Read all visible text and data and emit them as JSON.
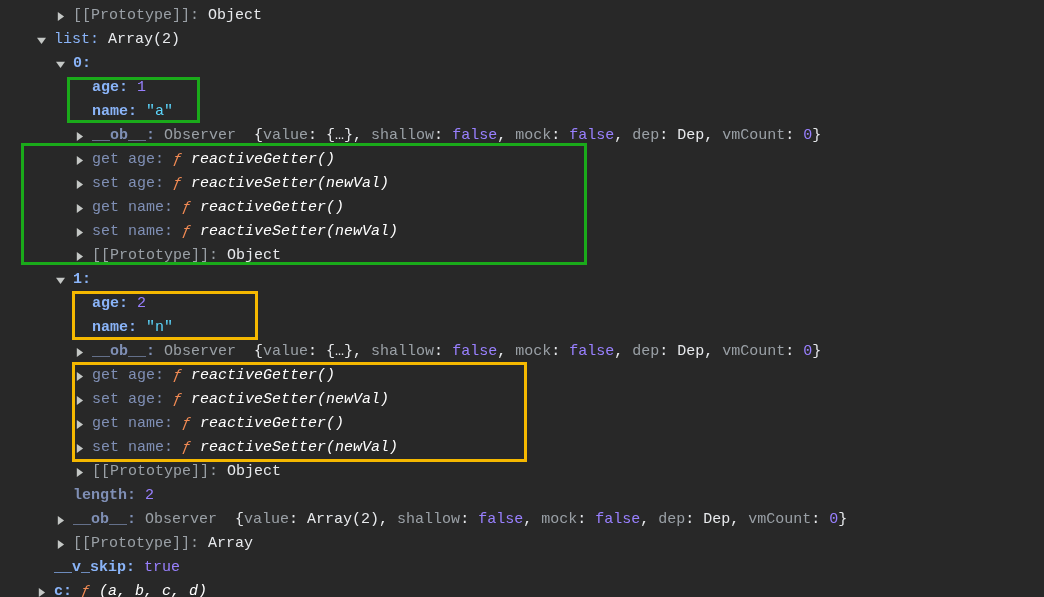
{
  "tree": [
    {
      "children": [
        {
          "key": "[[Prototype]]:",
          "kind": "proto",
          "bold": false,
          "expanded": false,
          "value": [
            {
              "kind": "plain",
              "text": "Object"
            }
          ]
        }
      ]
    },
    {
      "key": "list:",
      "kind": "own",
      "bold": false,
      "expanded": true,
      "value": [
        {
          "kind": "plain",
          "text": "Array(2)"
        }
      ],
      "children": [
        {
          "key": "0:",
          "kind": "own",
          "bold": true,
          "expanded": true,
          "children": [
            {
              "kind": "box",
              "color": "#1aaa1a",
              "children": [
                {
                  "key": "age:",
                  "kind": "own",
                  "bold": true,
                  "value": [
                    {
                      "kind": "num",
                      "text": "1"
                    }
                  ]
                },
                {
                  "key": "name:",
                  "kind": "own",
                  "bold": true,
                  "value": [
                    {
                      "kind": "str",
                      "text": "\"a\""
                    }
                  ]
                }
              ]
            },
            {
              "key": "__ob__:",
              "kind": "inherited",
              "bold": true,
              "expanded": false,
              "value": [
                {
                  "kind": "dim",
                  "text": "Observer  "
                },
                {
                  "kind": "plain",
                  "text": "{"
                },
                {
                  "kind": "dim",
                  "text": "value"
                },
                {
                  "kind": "plain",
                  "text": ": {…}, "
                },
                {
                  "kind": "dim",
                  "text": "shallow"
                },
                {
                  "kind": "plain",
                  "text": ": "
                },
                {
                  "kind": "bool",
                  "text": "false"
                },
                {
                  "kind": "plain",
                  "text": ", "
                },
                {
                  "kind": "dim",
                  "text": "mock"
                },
                {
                  "kind": "plain",
                  "text": ": "
                },
                {
                  "kind": "bool",
                  "text": "false"
                },
                {
                  "kind": "plain",
                  "text": ", "
                },
                {
                  "kind": "dim",
                  "text": "dep"
                },
                {
                  "kind": "plain",
                  "text": ": Dep, "
                },
                {
                  "kind": "dim",
                  "text": "vmCount"
                },
                {
                  "kind": "plain",
                  "text": ": "
                },
                {
                  "kind": "num",
                  "text": "0"
                },
                {
                  "kind": "plain",
                  "text": "}"
                }
              ]
            },
            {
              "kind": "box",
              "color": "#1aaa1a",
              "children": [
                {
                  "key": "get age:",
                  "kind": "inherited",
                  "bold": false,
                  "expanded": false,
                  "value": [
                    {
                      "kind": "fn",
                      "text": "ƒ "
                    },
                    {
                      "kind": "fname",
                      "text": "reactiveGetter()"
                    }
                  ]
                },
                {
                  "key": "set age:",
                  "kind": "inherited",
                  "bold": false,
                  "expanded": false,
                  "value": [
                    {
                      "kind": "fn",
                      "text": "ƒ "
                    },
                    {
                      "kind": "fname",
                      "text": "reactiveSetter(newVal)"
                    }
                  ]
                },
                {
                  "key": "get name:",
                  "kind": "inherited",
                  "bold": false,
                  "expanded": false,
                  "value": [
                    {
                      "kind": "fn",
                      "text": "ƒ "
                    },
                    {
                      "kind": "fname",
                      "text": "reactiveGetter()"
                    }
                  ]
                },
                {
                  "key": "set name:",
                  "kind": "inherited",
                  "bold": false,
                  "expanded": false,
                  "value": [
                    {
                      "kind": "fn",
                      "text": "ƒ "
                    },
                    {
                      "kind": "fname",
                      "text": "reactiveSetter(newVal)"
                    }
                  ]
                },
                {
                  "key": "[[Prototype]]:",
                  "kind": "proto",
                  "bold": false,
                  "expanded": false,
                  "value": [
                    {
                      "kind": "plain",
                      "text": "Object"
                    }
                  ]
                }
              ]
            }
          ]
        },
        {
          "key": "1:",
          "kind": "own",
          "bold": true,
          "expanded": true,
          "children": [
            {
              "kind": "box",
              "color": "#f5b800",
              "children": [
                {
                  "key": "age:",
                  "kind": "own",
                  "bold": true,
                  "value": [
                    {
                      "kind": "num",
                      "text": "2"
                    }
                  ]
                },
                {
                  "key": "name:",
                  "kind": "own",
                  "bold": true,
                  "value": [
                    {
                      "kind": "str",
                      "text": "\"n\""
                    }
                  ]
                }
              ]
            },
            {
              "key": "__ob__:",
              "kind": "inherited",
              "bold": true,
              "expanded": false,
              "value": [
                {
                  "kind": "dim",
                  "text": "Observer  "
                },
                {
                  "kind": "plain",
                  "text": "{"
                },
                {
                  "kind": "dim",
                  "text": "value"
                },
                {
                  "kind": "plain",
                  "text": ": {…}, "
                },
                {
                  "kind": "dim",
                  "text": "shallow"
                },
                {
                  "kind": "plain",
                  "text": ": "
                },
                {
                  "kind": "bool",
                  "text": "false"
                },
                {
                  "kind": "plain",
                  "text": ", "
                },
                {
                  "kind": "dim",
                  "text": "mock"
                },
                {
                  "kind": "plain",
                  "text": ": "
                },
                {
                  "kind": "bool",
                  "text": "false"
                },
                {
                  "kind": "plain",
                  "text": ", "
                },
                {
                  "kind": "dim",
                  "text": "dep"
                },
                {
                  "kind": "plain",
                  "text": ": Dep, "
                },
                {
                  "kind": "dim",
                  "text": "vmCount"
                },
                {
                  "kind": "plain",
                  "text": ": "
                },
                {
                  "kind": "num",
                  "text": "0"
                },
                {
                  "kind": "plain",
                  "text": "}"
                }
              ]
            },
            {
              "kind": "box",
              "color": "#f5b800",
              "children": [
                {
                  "key": "get age:",
                  "kind": "inherited",
                  "bold": false,
                  "expanded": false,
                  "value": [
                    {
                      "kind": "fn",
                      "text": "ƒ "
                    },
                    {
                      "kind": "fname",
                      "text": "reactiveGetter()"
                    }
                  ]
                },
                {
                  "key": "set age:",
                  "kind": "inherited",
                  "bold": false,
                  "expanded": false,
                  "value": [
                    {
                      "kind": "fn",
                      "text": "ƒ "
                    },
                    {
                      "kind": "fname",
                      "text": "reactiveSetter(newVal)"
                    }
                  ]
                },
                {
                  "key": "get name:",
                  "kind": "inherited",
                  "bold": false,
                  "expanded": false,
                  "value": [
                    {
                      "kind": "fn",
                      "text": "ƒ "
                    },
                    {
                      "kind": "fname",
                      "text": "reactiveGetter()"
                    }
                  ]
                },
                {
                  "key": "set name:",
                  "kind": "inherited",
                  "bold": false,
                  "expanded": false,
                  "value": [
                    {
                      "kind": "fn",
                      "text": "ƒ "
                    },
                    {
                      "kind": "fname",
                      "text": "reactiveSetter(newVal)"
                    }
                  ]
                }
              ]
            },
            {
              "key": "[[Prototype]]:",
              "kind": "proto",
              "bold": false,
              "expanded": false,
              "value": [
                {
                  "kind": "plain",
                  "text": "Object"
                }
              ]
            }
          ]
        },
        {
          "key": "length:",
          "kind": "inherited",
          "bold": true,
          "value": [
            {
              "kind": "num",
              "text": "2"
            }
          ]
        },
        {
          "key": "__ob__:",
          "kind": "inherited",
          "bold": true,
          "expanded": false,
          "value": [
            {
              "kind": "dim",
              "text": "Observer  "
            },
            {
              "kind": "plain",
              "text": "{"
            },
            {
              "kind": "dim",
              "text": "value"
            },
            {
              "kind": "plain",
              "text": ": Array(2), "
            },
            {
              "kind": "dim",
              "text": "shallow"
            },
            {
              "kind": "plain",
              "text": ": "
            },
            {
              "kind": "bool",
              "text": "false"
            },
            {
              "kind": "plain",
              "text": ", "
            },
            {
              "kind": "dim",
              "text": "mock"
            },
            {
              "kind": "plain",
              "text": ": "
            },
            {
              "kind": "bool",
              "text": "false"
            },
            {
              "kind": "plain",
              "text": ", "
            },
            {
              "kind": "dim",
              "text": "dep"
            },
            {
              "kind": "plain",
              "text": ": Dep, "
            },
            {
              "kind": "dim",
              "text": "vmCount"
            },
            {
              "kind": "plain",
              "text": ": "
            },
            {
              "kind": "num",
              "text": "0"
            },
            {
              "kind": "plain",
              "text": "}"
            }
          ]
        },
        {
          "key": "[[Prototype]]:",
          "kind": "proto",
          "bold": false,
          "expanded": false,
          "value": [
            {
              "kind": "plain",
              "text": "Array"
            }
          ]
        }
      ]
    },
    {
      "key": "__v_skip:",
      "kind": "own",
      "bold": true,
      "value": [
        {
          "kind": "bool",
          "text": "true"
        }
      ]
    },
    {
      "key": "c:",
      "kind": "own",
      "bold": true,
      "expanded": false,
      "value": [
        {
          "kind": "fn",
          "text": "ƒ "
        },
        {
          "kind": "fname",
          "text": "(a, b, c, d)"
        }
      ]
    }
  ]
}
